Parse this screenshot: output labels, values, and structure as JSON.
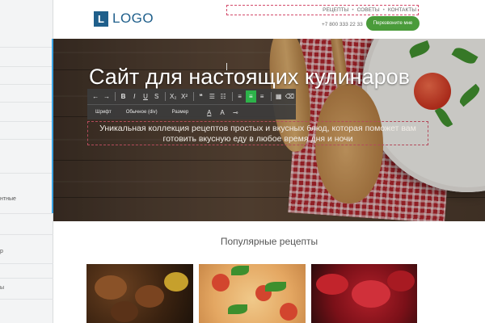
{
  "sidebar": {
    "items": [
      "нтные",
      "р",
      "ы"
    ]
  },
  "header": {
    "logo_letter": "L",
    "logo_text": "LOGO",
    "nav": [
      "РЕЦЕПТЫ",
      "СОВЕТЫ",
      "КОНТАКТЫ"
    ],
    "nav_separator": "•",
    "phone": "+7 800 333 22 33",
    "callback_label": "Перезвоните мне"
  },
  "hero": {
    "title": "Сайт для настоящих кулинаров",
    "subtitle": "Уникальная коллекция рецептов простых и вкусных блюд, которая поможет вам готовить вкусную еду в любое время дня и ночи"
  },
  "editor_toolbar": {
    "row1_icons": [
      {
        "name": "undo-icon",
        "glyph": "←"
      },
      {
        "name": "redo-icon",
        "glyph": "→"
      },
      {
        "name": "bold-icon",
        "glyph": "B"
      },
      {
        "name": "italic-icon",
        "glyph": "I"
      },
      {
        "name": "underline-icon",
        "glyph": "U"
      },
      {
        "name": "strikethrough-icon",
        "glyph": "S"
      },
      {
        "name": "subscript-icon",
        "glyph": "X₂"
      },
      {
        "name": "superscript-icon",
        "glyph": "X²"
      },
      {
        "name": "blockquote-icon",
        "glyph": "❝"
      },
      {
        "name": "bulleted-list-icon",
        "glyph": "☰"
      },
      {
        "name": "numbered-list-icon",
        "glyph": "☷"
      },
      {
        "name": "align-left-icon",
        "glyph": "≡"
      },
      {
        "name": "align-center-icon",
        "glyph": "≡"
      },
      {
        "name": "align-right-icon",
        "glyph": "≡"
      },
      {
        "name": "table-icon",
        "glyph": "▦"
      },
      {
        "name": "clear-format-icon",
        "glyph": "⌫"
      }
    ],
    "font_label": "Шрифт",
    "format_label": "Обычное (div)",
    "size_label": "Размер",
    "row2_icons": [
      {
        "name": "text-color-icon",
        "glyph": "A"
      },
      {
        "name": "background-color-icon",
        "glyph": "A"
      },
      {
        "name": "link-icon",
        "glyph": "⊸"
      }
    ],
    "active_color": "#2db34a"
  },
  "popular": {
    "title": "Популярные рецепты"
  },
  "colors": {
    "brand": "#1f5f8b",
    "callback_button": "#4a9b3a",
    "selection_outline": "#d24a6a"
  }
}
